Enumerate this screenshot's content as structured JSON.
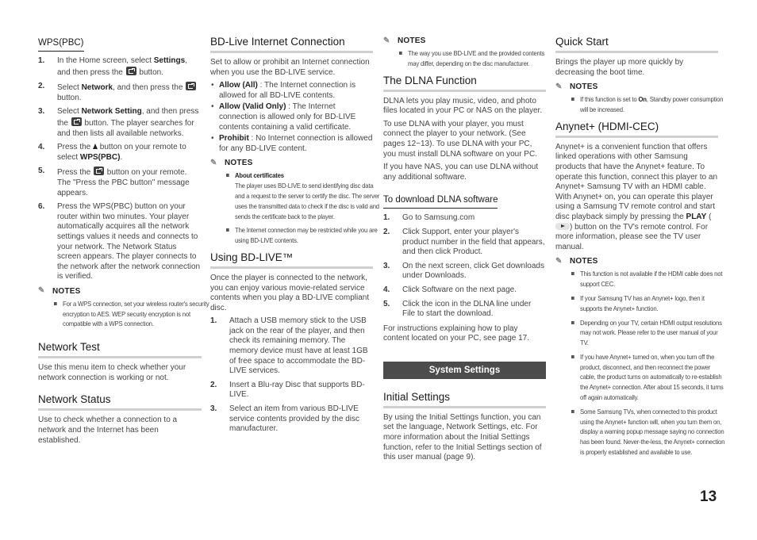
{
  "page_number": "13",
  "wps": {
    "title": "WPS(PBC)",
    "steps": [
      {
        "num": "1.",
        "pre": "In the Home screen, select ",
        "bold": "Settings",
        "post": ", and then press the ",
        "icon": "enter-button-icon",
        "tail": " button."
      },
      {
        "num": "2.",
        "pre": "Select ",
        "bold": "Network",
        "post": ", and then press the ",
        "icon": "enter-button-icon",
        "tail": " button."
      },
      {
        "num": "3.",
        "pre": "Select ",
        "bold": "Network Setting",
        "post": ", and then press the ",
        "icon": "enter-button-icon",
        "tail": " button. The player searches for and then lists all available networks."
      },
      {
        "num": "4.",
        "pre": "Press the ",
        "icon_up": "up-arrow-icon",
        "mid": " button on your remote to select ",
        "bold": "WPS(PBC)",
        "tail": "."
      },
      {
        "num": "5.",
        "pre": "Press the ",
        "icon": "enter-button-icon",
        "tail": " button on your remote. The \"Press the PBC button\" message appears."
      },
      {
        "num": "6.",
        "text": "Press the WPS(PBC) button on your router within two minutes. Your player automatically acquires all the network settings values it needs and connects to your network. The Network Status screen appears. The player connects to the network after the network connection is verified."
      }
    ],
    "notes_label": "NOTES",
    "notes": [
      "For a WPS connection, set your wireless router's security encryption to AES. WEP security encryption is not compatible with a WPS connection."
    ]
  },
  "network_test": {
    "title": "Network Test",
    "body": "Use this menu item to check whether your network connection is working or not."
  },
  "network_status": {
    "title": "Network Status",
    "body": "Use to check whether a connection to a network and the Internet has been established."
  },
  "bdlive_connection": {
    "title": "BD-Live Internet Connection",
    "intro": "Set to allow or prohibit an Internet connection when you use the BD-LIVE service.",
    "options": [
      {
        "bold": "Allow (All)",
        "text": " : The Internet connection is allowed for all BD-LIVE contents."
      },
      {
        "bold": "Allow (Valid Only)",
        "text": " : The Internet connection is allowed only for BD-LIVE contents containing a valid certificate."
      },
      {
        "bold": "Prohibit",
        "text": " : No Internet connection is allowed for any BD-LIVE content."
      }
    ],
    "notes_label": "NOTES",
    "notes": [
      {
        "bold": "About certificates",
        "text": "The player uses BD-LIVE to send identifying disc data and a request to the server to certify the disc. The server uses the transmitted data to check if the disc is valid and sends the certificate back to the player."
      },
      {
        "bold": "",
        "text": "The Internet connection may be restricted while you are using BD-LIVE contents."
      }
    ]
  },
  "using_bdlive": {
    "title": "Using BD-LIVE™",
    "intro": "Once the player is connected to the network, you can enjoy various movie-related service contents when you play a BD-LIVE compliant disc.",
    "steps": [
      {
        "num": "1.",
        "text": "Attach a USB memory stick to the USB jack on the rear of the player, and then check its remaining memory. The memory device must have at least 1GB of free space to accommodate the BD-LIVE services."
      },
      {
        "num": "2.",
        "text": "Insert a Blu-ray Disc that supports BD-LIVE."
      },
      {
        "num": "3.",
        "text": "Select an item from various BD-LIVE service contents provided by the disc manufacturer."
      }
    ],
    "notes_label": "NOTES",
    "notes": [
      "The way you use BD-LIVE and the provided contents may differ, depending on the disc manufacturer."
    ]
  },
  "dlna": {
    "title": "The DLNA Function",
    "paragraphs": [
      "DLNA lets you play music, video, and photo files located in your PC or NAS on the player.",
      "To use DLNA with your player, you must connect the player to your network. (See pages 12~13). To use DLNA with your PC, you must install DLNA software on your PC.",
      "If you have NAS, you can use DLNA without any additional software."
    ],
    "download_title": "To download DLNA software",
    "download_steps": [
      {
        "num": "1.",
        "text": "Go to Samsung.com"
      },
      {
        "num": "2.",
        "text": "Click Support, enter your player's product number in the field that appears, and then click Product."
      },
      {
        "num": "3.",
        "text": "On the next screen, click Get downloads under Downloads."
      },
      {
        "num": "4.",
        "text": "Click Software on the next page."
      },
      {
        "num": "5.",
        "text": "Click the icon in the DLNA line under File to start the download."
      }
    ],
    "footer": "For instructions explaining how to play content located on your PC, see page 17."
  },
  "system_settings_bar": "System Settings",
  "initial_settings": {
    "title": "Initial Settings",
    "body": "By using the Initial Settings function, you can set the language, Network Settings, etc. For more information about the Initial Settings function, refer to the Initial Settings section of this user manual (page 9)."
  },
  "quick_start": {
    "title": "Quick Start",
    "body": "Brings the player up more quickly by decreasing the boot time.",
    "notes_label": "NOTES",
    "note_pre": "If this function is set to ",
    "note_bold": "On",
    "note_post": ", Standby power consumption will be increased."
  },
  "anynet": {
    "title": "Anynet+ (HDMI-CEC)",
    "body_pre": "Anynet+ is a convenient function that offers linked operations with other Samsung products that have the Anynet+ feature. To operate this function, connect this player to an Anynet+ Samsung TV with an HDMI cable. With Anynet+ on, you can operate this player using a Samsung TV remote control and start disc playback simply by pressing the ",
    "body_bold": "PLAY",
    "body_open": " (",
    "body_post": ") button on the TV's remote control. For more information, please see the TV user manual.",
    "notes_label": "NOTES",
    "notes": [
      "This function is not available if the HDMI cable does not support CEC.",
      "If your Samsung TV has an Anynet+ logo, then it supports the Anynet+ function.",
      "Depending on your TV, certain HDMI output resolutions may not work. Please refer to the user manual of your TV.",
      "If you have Anynet+ turned on, when you turn off the product, disconnect, and then reconnect the power cable, the product turns on automatically to re-establish the Anynet+ connection. After about 15 seconds, it turns off again automatically.",
      "Some Samsung TVs, when connected to this product using the Anynet+ function will, when you turn them on, display a warning popup message saying no connection has been found. Never-the-less, the Anynet+ connection is properly established and available to use."
    ]
  }
}
